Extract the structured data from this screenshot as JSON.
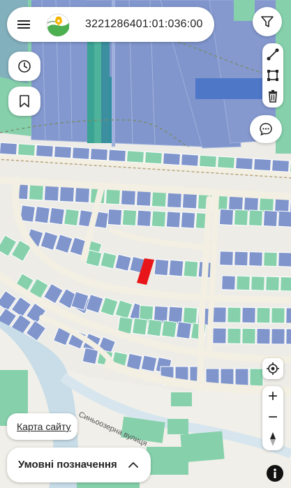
{
  "search": {
    "cadastral_number": "3221286401:01:036:00"
  },
  "map": {
    "street_label": "Синьоозерна вулиця",
    "colors": {
      "land_blue": "#7f95cc",
      "land_green": "#86d1ac",
      "selected_parcel": "#e8161a",
      "road": "#f3efe2",
      "water": "#c8dde8"
    }
  },
  "controls": {
    "menu_icon": "hamburger-menu-icon",
    "filter_icon": "funnel-icon",
    "history_icon": "clock-icon",
    "bookmark_icon": "bookmark-icon",
    "measure_line_icon": "line-measure-icon",
    "measure_area_icon": "area-measure-icon",
    "delete_icon": "trash-icon",
    "chat_icon": "chat-bubble-icon",
    "locate_icon": "crosshair-icon",
    "zoom_in_label": "+",
    "zoom_out_label": "−",
    "compass_icon": "compass-icon"
  },
  "footer": {
    "sitemap_link": "Карта сайту",
    "legend_label": "Умовні позначення",
    "info_icon": "info-icon"
  }
}
